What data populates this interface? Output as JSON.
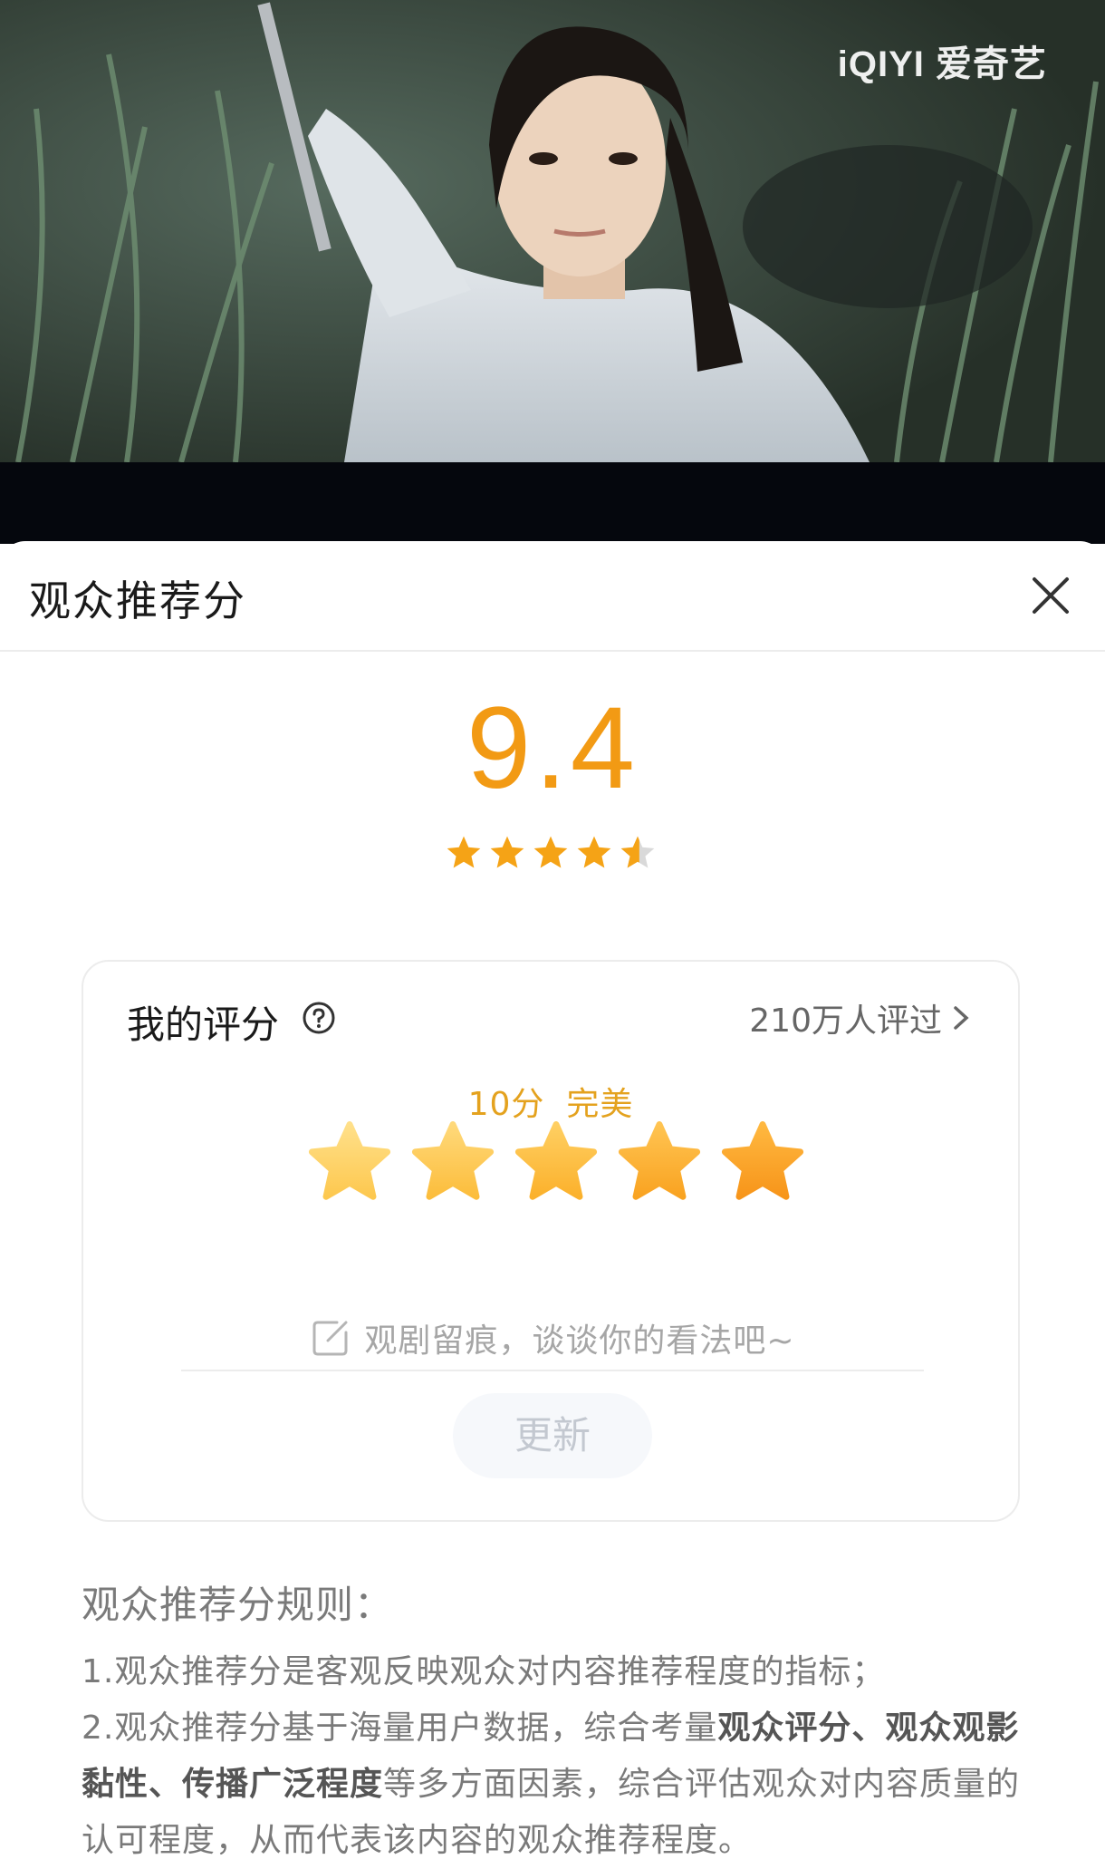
{
  "video": {
    "watermark": "iQIYI 爱奇艺"
  },
  "sheet": {
    "title": "观众推荐分",
    "close_icon": "close-icon",
    "score": "9.4",
    "score_stars": 4.7,
    "score_color": "#f29a14"
  },
  "my_rating": {
    "title": "我的评分",
    "rated_count": "210万人评过",
    "rating_value": "10分",
    "rating_desc": "完美",
    "stars_filled": 5,
    "comment_placeholder": "观剧留痕，谈谈你的看法吧~",
    "update_label": "更新"
  },
  "rules": {
    "title": "观众推荐分规则：",
    "line1": "1.观众推荐分是客观反映观众对内容推荐程度的指标；",
    "line2_pre": "2.观众推荐分基于海量用户数据，综合考量",
    "line2_bold": "观众评分、观众观影黏性、传播广泛程度",
    "line2_post": "等多方面因素，综合评估观众对内容质量的认可程度，从而代表该内容的观众推荐程度。"
  }
}
